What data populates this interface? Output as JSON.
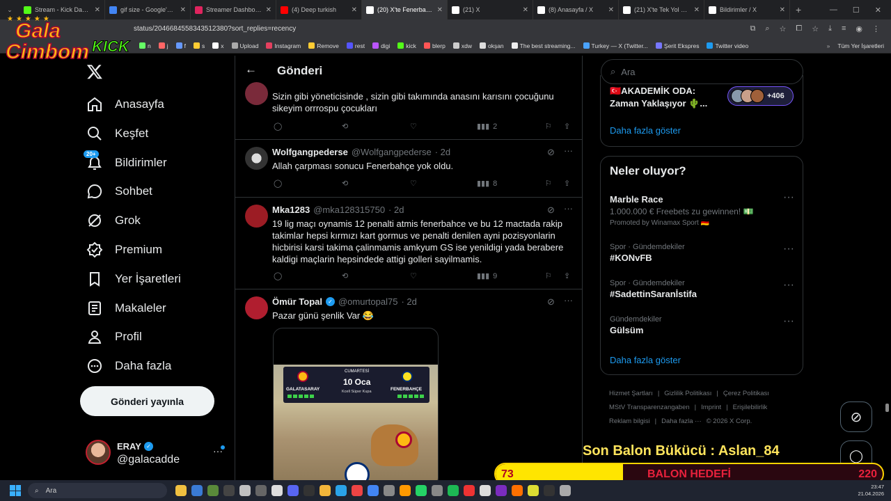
{
  "browser": {
    "tabs": [
      {
        "label": "Stream - Kick Dashb",
        "color": "#53fc18"
      },
      {
        "label": "gif size - Google'da A",
        "color": "#4285f4"
      },
      {
        "label": "Streamer Dashboard",
        "color": "#e0245e"
      },
      {
        "label": "(4) Deep turkish",
        "color": "#ff0000"
      },
      {
        "label": "(20) X'te Fenerbahçe",
        "color": "#ffffff"
      },
      {
        "label": "(21) X",
        "color": "#ffffff"
      },
      {
        "label": "(8) Anasayfa / X",
        "color": "#ffffff"
      },
      {
        "label": "(21) X'te Tek Yol FENE",
        "color": "#ffffff"
      },
      {
        "label": "Bildirimler / X",
        "color": "#ffffff"
      }
    ],
    "url": "status/2046684558343512380?sort_replies=recency",
    "bookmarks": [
      "n",
      "j",
      "f",
      "s",
      "x",
      "Upload",
      "Instagram",
      "Remove",
      "rest",
      "digi",
      "kick",
      "blerp",
      "xdw",
      "okşan",
      "The best streaming...",
      "Turkey — X (Twitter...",
      "Şerit Ekspres",
      "Twitter video"
    ],
    "all_bookmarks": "Tüm Yer İşaretleri"
  },
  "overlay": {
    "logo_line1": "Gala",
    "logo_line2": "Cimbom",
    "logo_kick": "KICK",
    "son_balon": "Son Balon Bükücü : Aslan_84",
    "balon_current": "73",
    "balon_label": "BALON HEDEFİ",
    "balon_target": "220",
    "balon_progress": 0.33
  },
  "sidebar": {
    "items": [
      {
        "label": "Anasayfa",
        "icon": "home-icon"
      },
      {
        "label": "Keşfet",
        "icon": "search-icon"
      },
      {
        "label": "Bildirimler",
        "icon": "bell-icon",
        "badge": "20+"
      },
      {
        "label": "Sohbet",
        "icon": "chat-icon"
      },
      {
        "label": "Grok",
        "icon": "grok-icon"
      },
      {
        "label": "Premium",
        "icon": "verified-icon"
      },
      {
        "label": "Yer İşaretleri",
        "icon": "bookmark-icon"
      },
      {
        "label": "Makaleler",
        "icon": "article-icon"
      },
      {
        "label": "Profil",
        "icon": "person-icon"
      },
      {
        "label": "Daha fazla",
        "icon": "more-icon"
      }
    ],
    "post_button": "Gönderi yayınla",
    "user": {
      "name": "ERAY",
      "handle": "@galacadde"
    }
  },
  "main": {
    "title": "Gönderi",
    "posts": [
      {
        "text": "Sizin gibi yöneticisinde , sizin gibi takımında anasını karısını çocuğunu sikeyim orrrospu çocukları",
        "views": "2"
      },
      {
        "name": "Wolfgangpederse",
        "handle": "@Wolfgangpederse",
        "time": "· 2d",
        "text": "Allah çarpması sonucu Fenerbahçe yok oldu.",
        "views": "8"
      },
      {
        "name": "Mka1283",
        "handle": "@mka128315750",
        "time": "· 2d",
        "text": "19 lig maçı oynamis 12 penalti atmis fenerbahce ve bu 12 mactada rakip takimlar hepsi kırmızı kart gormus ve penalti denilen ayni pozisyonlarin hicbirisi karsi takima çalinmamis amkyum GS ise yenildigi yada berabere kaldigi maçlarin hepsindede attigi golleri sayilmamis.",
        "views": "9"
      },
      {
        "name": "Ömür Topal",
        "handle": "@omurtopal75",
        "time": "· 2d",
        "text": "Pazar günü şenlik Var 😂"
      }
    ],
    "media": {
      "team1": "GALATASARAY",
      "team2": "FENERBAHÇE",
      "day": "CUMARTESİ",
      "date": "10 Oca",
      "cup": "Kcell Süper Kupa"
    }
  },
  "right": {
    "search_placeholder": "Ara",
    "space_title": "🇹🇷AKADEMİK ODA: Zaman Yaklaşıyor 🌵...",
    "space_count": "+406",
    "show_more": "Daha fazla göster",
    "trends_title": "Neler oluyor?",
    "trends": [
      {
        "meta": "",
        "name": "Marble Race",
        "desc": "1.000.000 € Freebets zu gewinnen! 💵",
        "promo": "Promoted by Winamax Sport 🇩🇪"
      },
      {
        "meta": "Spor · Gündemdekiler",
        "name": "#KONvFB"
      },
      {
        "meta": "Spor · Gündemdekiler",
        "name": "#SadettinSaranİstifa"
      },
      {
        "meta": "Gündemdekiler",
        "name": "Gülsüm"
      }
    ],
    "footer": [
      "Hizmet Şartları",
      "Gizlilik Politikası",
      "Çerez Politikası",
      "MStV Transparenzangaben",
      "Imprint",
      "Erişilebilirlik",
      "Reklam bilgisi",
      "Daha fazla ···",
      "© 2026 X Corp."
    ]
  },
  "taskbar": {
    "search": "Ara",
    "time": "23:47",
    "date": "21.04.2026"
  },
  "colors": {
    "accent": "#1d9bf0",
    "background": "#000000",
    "border": "#2f3336",
    "muted": "#71767b"
  }
}
